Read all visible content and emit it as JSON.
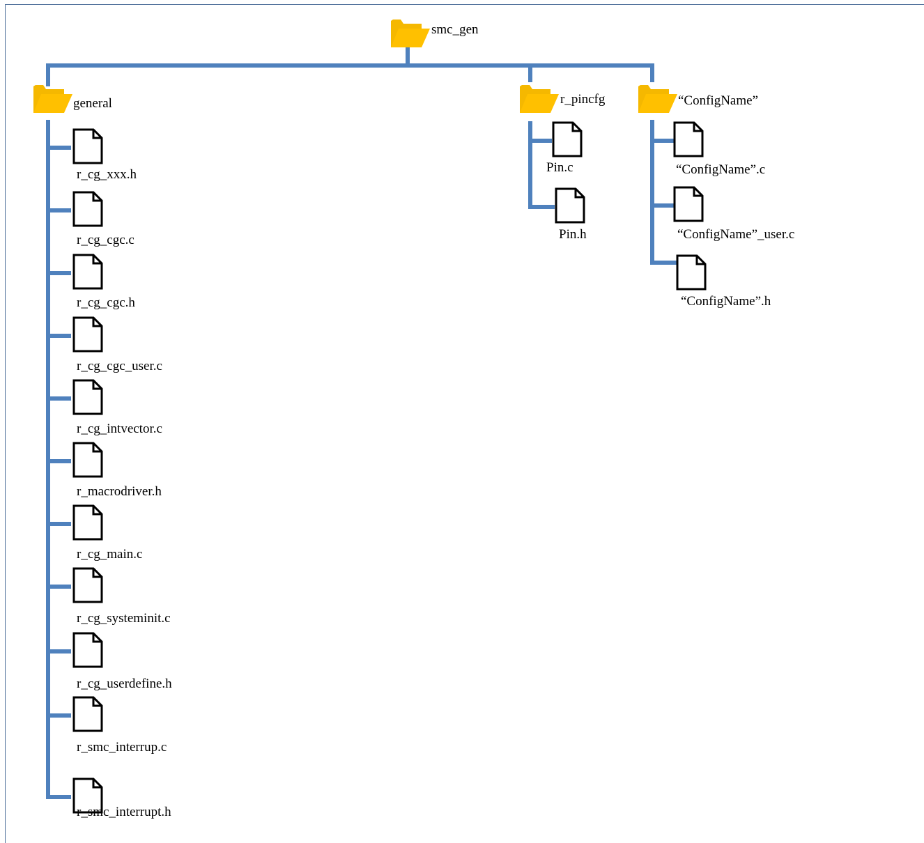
{
  "root": {
    "label": "smc_gen",
    "icon": "folder-icon"
  },
  "folders": [
    {
      "id": "general",
      "label": "general",
      "icon": "folder-icon",
      "files": [
        {
          "label": "r_cg_xxx.h",
          "icon": "file-icon"
        },
        {
          "label": "r_cg_cgc.c",
          "icon": "file-icon"
        },
        {
          "label": "r_cg_cgc.h",
          "icon": "file-icon"
        },
        {
          "label": "r_cg_cgc_user.c",
          "icon": "file-icon"
        },
        {
          "label": "r_cg_intvector.c",
          "icon": "file-icon"
        },
        {
          "label": "r_macrodriver.h",
          "icon": "file-icon"
        },
        {
          "label": "r_cg_main.c",
          "icon": "file-icon"
        },
        {
          "label": "r_cg_systeminit.c",
          "icon": "file-icon"
        },
        {
          "label": "r_cg_userdefine.h",
          "icon": "file-icon"
        },
        {
          "label": "r_smc_interrup.c",
          "icon": "file-icon"
        },
        {
          "label": "r_smc_interrupt.h",
          "icon": "file-icon"
        }
      ]
    },
    {
      "id": "pincfg",
      "label": "r_pincfg",
      "icon": "folder-icon",
      "files": [
        {
          "label": "Pin.c",
          "icon": "file-icon"
        },
        {
          "label": "Pin.h",
          "icon": "file-icon"
        }
      ]
    },
    {
      "id": "configname",
      "label": "“ConfigName”",
      "icon": "folder-icon",
      "files": [
        {
          "label": "“ConfigName”.c",
          "icon": "file-icon"
        },
        {
          "label": "“ConfigName”_user.c",
          "icon": "file-icon"
        },
        {
          "label": "“ConfigName”.h",
          "icon": "file-icon"
        }
      ]
    }
  ],
  "colors": {
    "connector": "#4f81bd",
    "folder_fill": "#ffc000",
    "folder_back": "#f5b800",
    "file_stroke": "#000000",
    "frame": "#4f6f9a"
  }
}
